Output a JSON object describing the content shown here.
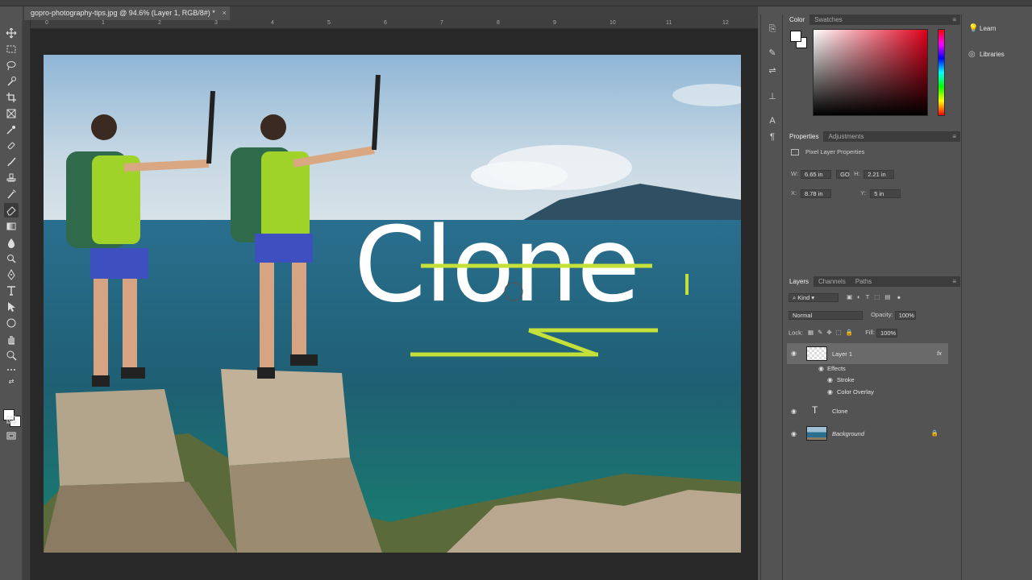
{
  "document": {
    "tab_title": "gopro-photography-tips.jpg @ 94.6% (Layer 1, RGB/8#) *",
    "close_glyph": "×"
  },
  "ruler_ticks": [
    "0",
    "1",
    "2",
    "3",
    "4",
    "5",
    "6",
    "7",
    "8",
    "9",
    "10",
    "11",
    "12"
  ],
  "canvas_text": "Clone",
  "color_panel": {
    "tabs": [
      "Color",
      "Swatches"
    ],
    "foreground": "#ffffff",
    "background": "#ffffff"
  },
  "properties_panel": {
    "tabs": [
      "Properties",
      "Adjustments"
    ],
    "title": "Pixel Layer Properties",
    "w_label": "W:",
    "w_value": "6.65 in",
    "link_label": "GO",
    "h_label": "H:",
    "h_value": "2.21 in",
    "x_label": "X:",
    "x_value": "8.78 in",
    "y_label": "Y:",
    "y_value": "5 in"
  },
  "layers_panel": {
    "tabs": [
      "Layers",
      "Channels",
      "Paths"
    ],
    "filter_label": "Kind",
    "blend_mode": "Normal",
    "opacity_label": "Opacity:",
    "opacity_value": "100%",
    "lock_label": "Lock:",
    "fill_label": "Fill:",
    "fill_value": "100%",
    "layers": [
      {
        "name": "Layer 1",
        "fx": "fx"
      },
      {
        "name": "Effects"
      },
      {
        "name": "Stroke"
      },
      {
        "name": "Color Overlay"
      },
      {
        "name": "Clone",
        "type_glyph": "T"
      },
      {
        "name": "Background"
      }
    ]
  },
  "learn_panel": {
    "items": [
      "Learn",
      "Libraries"
    ]
  },
  "colors": {
    "accent_green": "#c6e03a",
    "ui_bg": "#535353",
    "canvas_bg": "#282828"
  }
}
